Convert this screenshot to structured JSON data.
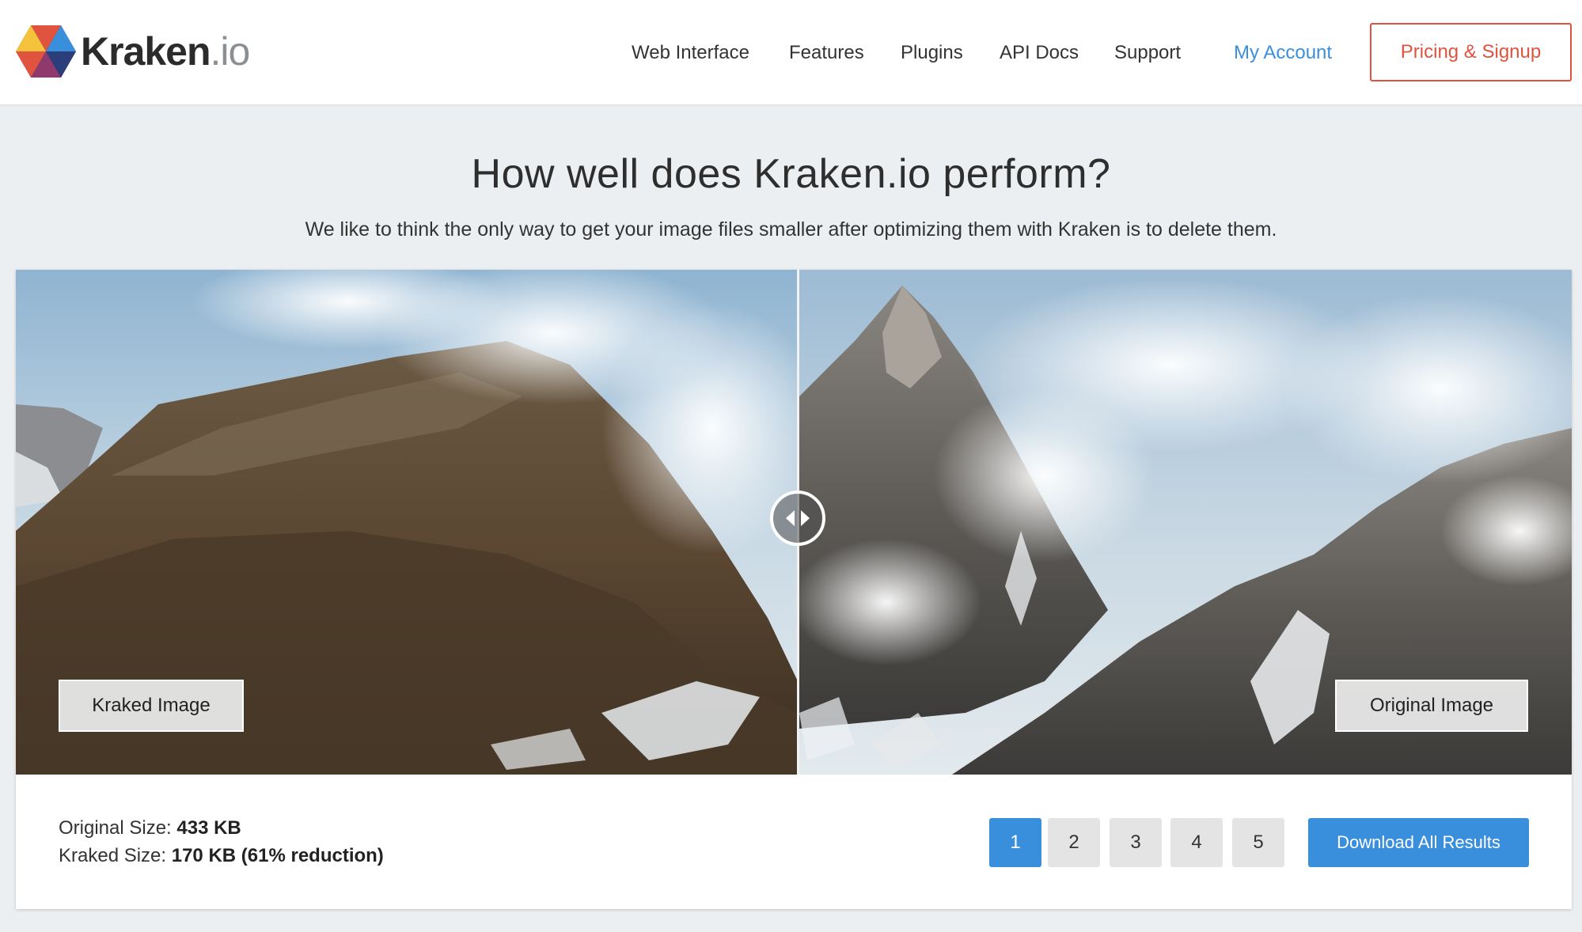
{
  "brand": {
    "name_main": "Kraken",
    "name_suffix": ".io",
    "colors": {
      "red": "#e0533f",
      "blue": "#3a8fdc",
      "yellow": "#f5c33b",
      "navy": "#2c3e7a"
    }
  },
  "nav": {
    "items": [
      {
        "label": "Web Interface"
      },
      {
        "label": "Features"
      },
      {
        "label": "Plugins"
      },
      {
        "label": "API Docs"
      },
      {
        "label": "Support"
      }
    ],
    "account_label": "My Account",
    "signup_label": "Pricing & Signup"
  },
  "hero": {
    "title": "How well does Kraken.io perform?",
    "subtitle": "We like to think the only way to get your image files smaller after optimizing them with Kraken is to delete them."
  },
  "comparison": {
    "left_label": "Kraked Image",
    "right_label": "Original Image",
    "original_size_label": "Original Size:",
    "original_size_value": "433 KB",
    "kraked_size_label": "Kraked Size:",
    "kraked_size_value": "170 KB (61% reduction)",
    "pages": [
      "1",
      "2",
      "3",
      "4",
      "5"
    ],
    "active_page": "1",
    "download_label": "Download All Results"
  }
}
